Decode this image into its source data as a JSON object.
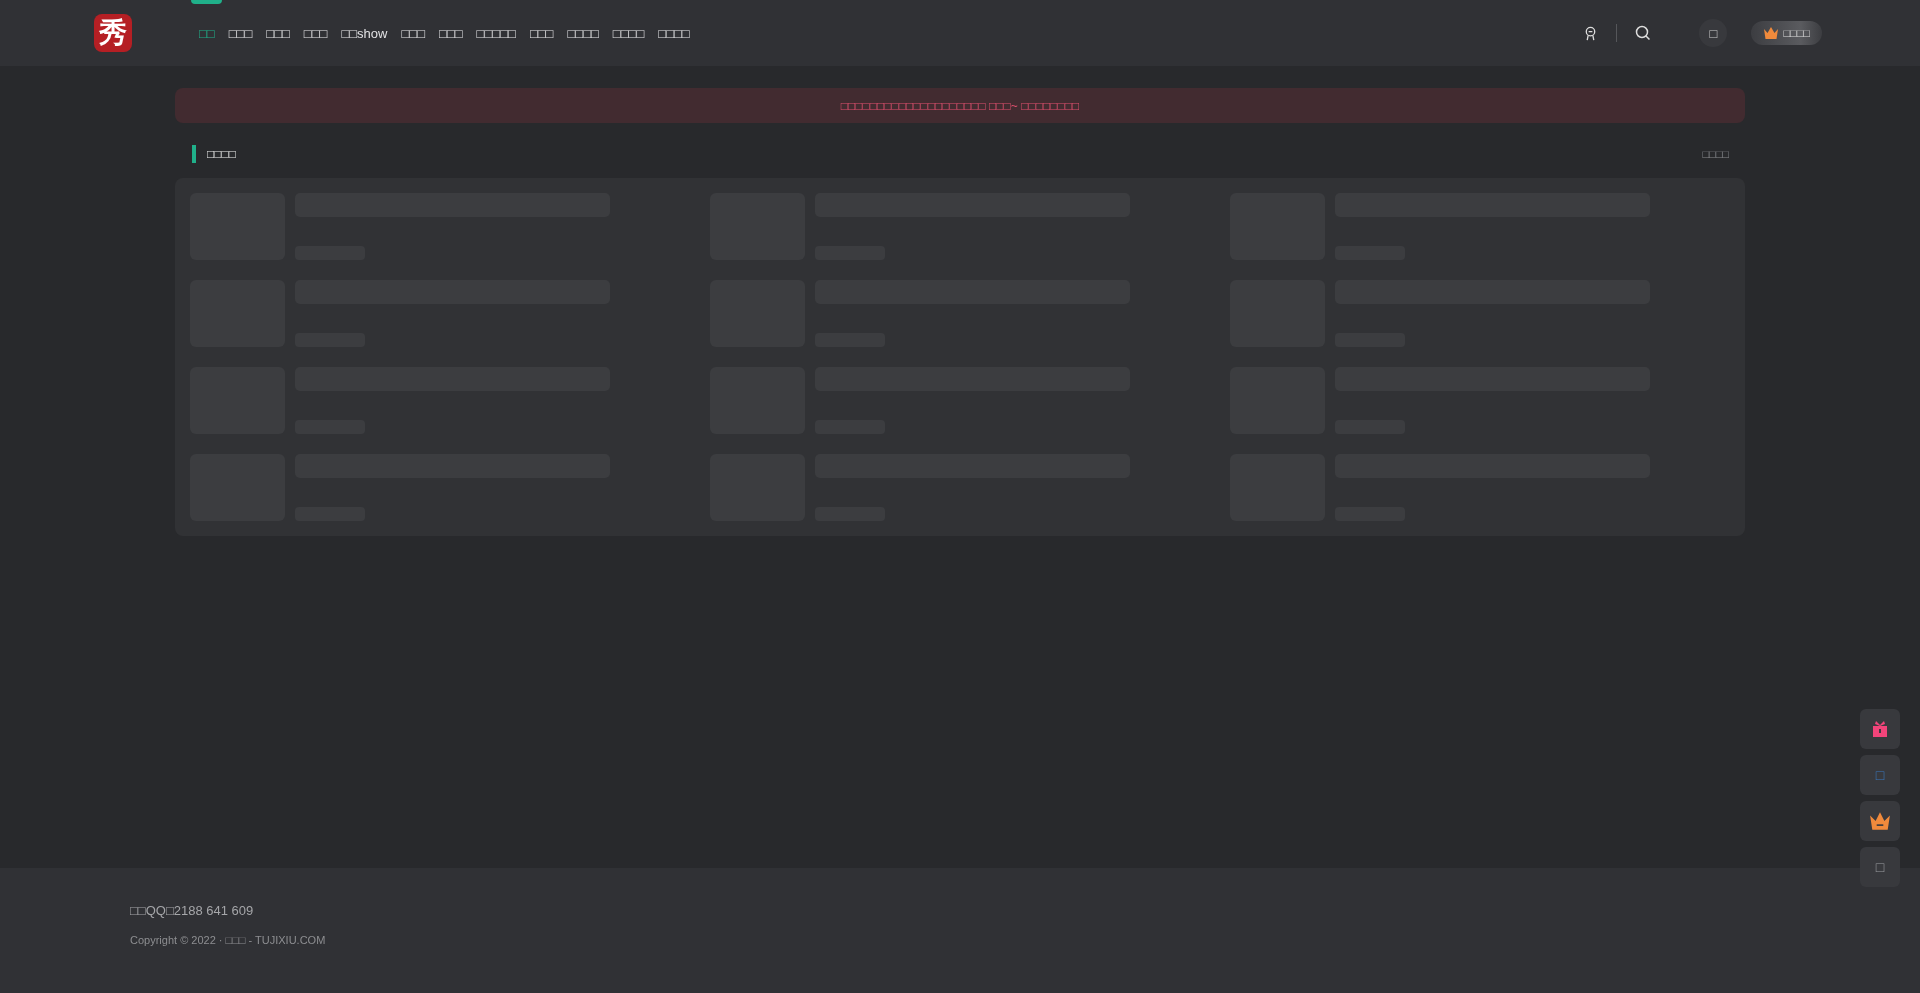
{
  "logo": {
    "text": "秀"
  },
  "nav": [
    {
      "label": "□□",
      "selected": true
    },
    {
      "label": "□□□",
      "selected": false
    },
    {
      "label": "□□□",
      "selected": false
    },
    {
      "label": "□□□",
      "selected": false
    },
    {
      "label": "□□show",
      "selected": false
    },
    {
      "label": "□□□",
      "selected": false
    },
    {
      "label": "□□□",
      "selected": false
    },
    {
      "label": "□□□□",
      "selected": false,
      "caret": "□"
    },
    {
      "label": "□□□",
      "selected": false
    },
    {
      "label": "□□□□",
      "selected": false
    },
    {
      "label": "□□□□",
      "selected": false
    },
    {
      "label": "□□□□",
      "selected": false
    }
  ],
  "header_actions": {
    "round_button": "□",
    "vip_button": "□□□□"
  },
  "notice": "□□□□□□□□□□□□□□□□□□□□ □□□~ □□□□□□□□",
  "section": {
    "title": "□□□□",
    "more": "□□□□"
  },
  "placeholders": [
    {
      "kind": "skeleton"
    },
    {
      "kind": "skeleton"
    },
    {
      "kind": "skeleton"
    },
    {
      "kind": "skeleton"
    },
    {
      "kind": "skeleton"
    },
    {
      "kind": "skeleton"
    },
    {
      "kind": "skeleton"
    },
    {
      "kind": "skeleton"
    },
    {
      "kind": "skeleton"
    },
    {
      "kind": "skeleton"
    },
    {
      "kind": "skeleton"
    },
    {
      "kind": "skeleton"
    }
  ],
  "footer": {
    "contact": "□□QQ□2188 641 609",
    "copyright": "Copyright © 2022 · □□□ - TUJIXIU.COM"
  },
  "float_buttons": [
    {
      "kind": "gift"
    },
    {
      "kind": "info",
      "text": "□"
    },
    {
      "kind": "crown"
    },
    {
      "kind": "top",
      "text": "□"
    }
  ]
}
